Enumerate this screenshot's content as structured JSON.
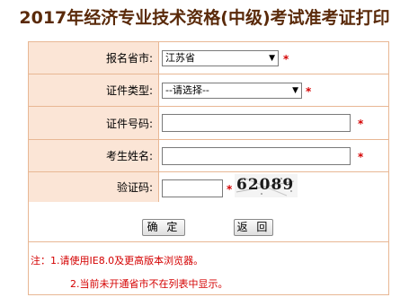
{
  "page": {
    "title": "2017年经济专业技术资格(中级)考试准考证打印"
  },
  "form": {
    "province": {
      "label": "报名省市:",
      "selected": "江苏省",
      "required_mark": "*"
    },
    "id_type": {
      "label": "证件类型:",
      "selected": "--请选择--",
      "required_mark": "*"
    },
    "id_number": {
      "label": "证件号码:",
      "value": "",
      "required_mark": "*"
    },
    "name": {
      "label": "考生姓名:",
      "value": "",
      "required_mark": "*"
    },
    "captcha": {
      "label": "验证码:",
      "value": "",
      "required_mark": "*",
      "image_text": "62089"
    }
  },
  "buttons": {
    "confirm_label": "确 定",
    "back_label": "返 回"
  },
  "notes": {
    "line1": "注：1.请使用IE8.0及更高版本浏览器。",
    "line2": "2.当前未开通省市不在列表中显示。"
  },
  "icons": {
    "dropdown": "chevron-down-icon"
  },
  "colors": {
    "title": "#5a2a0a",
    "label_bg": "#fbe5d6",
    "border": "#e8b794",
    "required": "#d40000",
    "note_text": "#d40000"
  }
}
